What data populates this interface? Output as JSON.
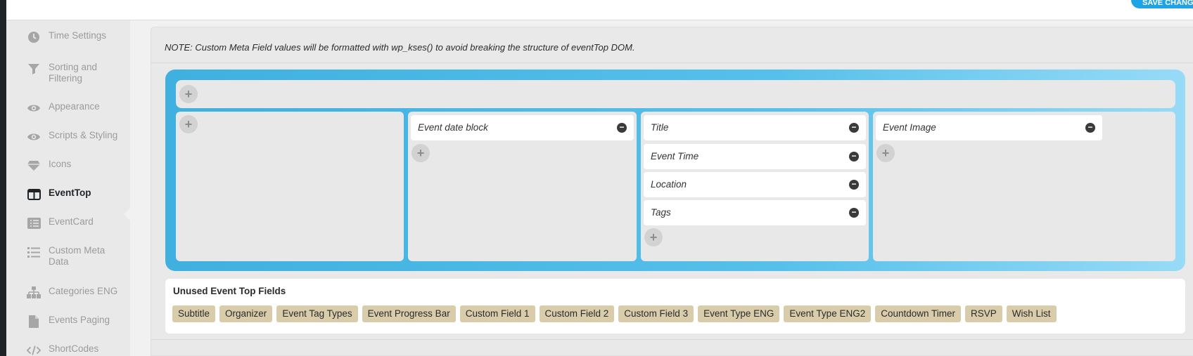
{
  "header": {
    "save_label": "SAVE CHANGES"
  },
  "sidebar": {
    "items": [
      {
        "label": "Time Settings",
        "icon": "clock-icon"
      },
      {
        "label": "Sorting and Filtering",
        "icon": "filter-icon"
      },
      {
        "label": "Appearance",
        "icon": "eye-icon"
      },
      {
        "label": "Scripts & Styling",
        "icon": "eye-icon"
      },
      {
        "label": "Icons",
        "icon": "diamond-icon"
      },
      {
        "label": "EventTop",
        "icon": "layout-columns-icon",
        "active": true
      },
      {
        "label": "EventCard",
        "icon": "list-card-icon"
      },
      {
        "label": "Custom Meta Data",
        "icon": "list-icon"
      },
      {
        "label": "Categories ENG",
        "icon": "sitemap-icon"
      },
      {
        "label": "Events Paging",
        "icon": "document-icon"
      },
      {
        "label": "ShortCodes",
        "icon": "code-icon"
      }
    ]
  },
  "main": {
    "note": "NOTE: Custom Meta Field values will be formatted with wp_kses() to avoid breaking the structure of eventTop DOM.",
    "add_symbol": "+",
    "remove_symbol": "−",
    "columns": [
      {
        "fields": []
      },
      {
        "fields": [
          "Event date block"
        ]
      },
      {
        "fields": [
          "Title",
          "Event Time",
          "Location",
          "Tags"
        ]
      },
      {
        "fields": [
          "Event Image"
        ]
      }
    ],
    "unused": {
      "title": "Unused Event Top Fields",
      "chips": [
        "Subtitle",
        "Organizer",
        "Event Tag Types",
        "Event Progress Bar",
        "Custom Field 1",
        "Custom Field 2",
        "Custom Field 3",
        "Event Type ENG",
        "Event Type ENG2",
        "Countdown Timer",
        "RSVP",
        "Wish List"
      ]
    }
  },
  "colors": {
    "accent": "#1fa3e8",
    "layout_gradient_start": "#3fb0df",
    "layout_gradient_end": "#97dbf6",
    "chip_bg": "#d9ccab"
  }
}
